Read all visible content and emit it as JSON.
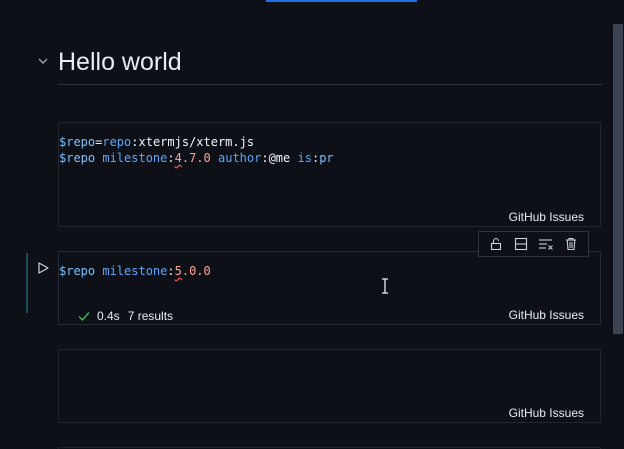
{
  "heading": {
    "title": "Hello world"
  },
  "cells": [
    {
      "lines": [
        [
          {
            "t": "$repo",
            "c": "tok-var"
          },
          {
            "t": "=",
            "c": "tok-op"
          },
          {
            "t": "repo",
            "c": "tok-kw"
          },
          {
            "t": ":xtermjs/xterm.js",
            "c": "tok-val"
          }
        ],
        [
          {
            "t": "$repo",
            "c": "tok-var"
          },
          {
            "t": " ",
            "c": "tok-op"
          },
          {
            "t": "milestone",
            "c": "tok-kw"
          },
          {
            "t": ":",
            "c": "tok-op"
          },
          {
            "t": "4",
            "c": "tok-num squiggle"
          },
          {
            "t": ".7.0",
            "c": "tok-num"
          },
          {
            "t": " ",
            "c": "tok-op"
          },
          {
            "t": "author",
            "c": "tok-kw"
          },
          {
            "t": ":@me",
            "c": "tok-val"
          },
          {
            "t": " ",
            "c": "tok-op"
          },
          {
            "t": "is",
            "c": "tok-kw"
          },
          {
            "t": ":",
            "c": "tok-op"
          },
          {
            "t": "pr",
            "c": "tok-var"
          }
        ]
      ],
      "renderer": "GitHub Issues"
    },
    {
      "lines": [
        [
          {
            "t": "$repo",
            "c": "tok-var"
          },
          {
            "t": " ",
            "c": "tok-op"
          },
          {
            "t": "milestone",
            "c": "tok-kw"
          },
          {
            "t": ":",
            "c": "tok-op"
          },
          {
            "t": "5",
            "c": "tok-num squiggle"
          },
          {
            "t": ".0.0",
            "c": "tok-num"
          }
        ]
      ],
      "status": {
        "time": "0.4s",
        "results": "7 results"
      },
      "renderer": "GitHub Issues"
    },
    {
      "lines": [],
      "renderer": "GitHub Issues"
    }
  ],
  "toolbar": {
    "buttons": [
      "unlock-icon",
      "split-cell-icon",
      "clear-output-icon",
      "trash-icon"
    ]
  },
  "colors": {
    "background": "#0d1117",
    "accent": "#1f6feb",
    "success": "#3fb950"
  }
}
